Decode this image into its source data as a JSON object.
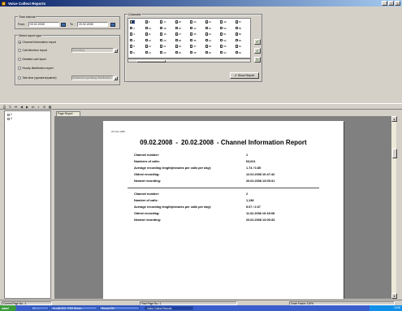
{
  "window": {
    "title": "Voice Collect Reports"
  },
  "time_interval": {
    "group_title": "Time interval",
    "from_label": "From",
    "from_value": "09.02.2008",
    "to_label": "To",
    "to_value": "20.02.2008"
  },
  "report_type": {
    "group_title": "Select report type",
    "options": [
      {
        "label": "Channel information report",
        "selected": true
      },
      {
        "label": "Call direction report",
        "selected": false,
        "extra": "Incoming"
      },
      {
        "label": "Detailed call report",
        "selected": false
      },
      {
        "label": "Hourly distribution report",
        "selected": false
      },
      {
        "label": "Talk time (speakers/paired)",
        "selected": false,
        "extra": "Minimum speaking distribution"
      }
    ]
  },
  "channels": {
    "group_title": "Channels",
    "columns": [
      [
        "1",
        "2",
        "3",
        "4",
        "5",
        "6"
      ],
      [
        "9",
        "10",
        "11",
        "12",
        "13",
        "14"
      ],
      [
        "17",
        "18",
        "19",
        "20",
        "21",
        "22"
      ],
      [
        "25",
        "26",
        "27",
        "28",
        "29",
        "30"
      ],
      [
        "33",
        "34",
        "35",
        "36",
        "37",
        "38"
      ],
      [
        "41",
        "42",
        "43",
        "44",
        "45",
        "46"
      ],
      [
        "49",
        "50",
        "51",
        "52",
        "53",
        "54"
      ],
      [
        "57",
        "58",
        "59",
        "60",
        "61",
        "62"
      ]
    ],
    "selected": "1"
  },
  "show_report_label": "Show Report",
  "tree": {
    "nodes": [
      "1",
      "2"
    ]
  },
  "tab_label": "Page Report",
  "report": {
    "print_date": "20 Feb 2008",
    "title_from": "09.02.2008",
    "title_sep": "-",
    "title_to": "20.02.2008",
    "title_rest": "- Channel Information Report",
    "sections": [
      {
        "rows": [
          {
            "key": "Channel number:",
            "value": "1"
          },
          {
            "key": "Numbers of calls:",
            "value": "63,621"
          },
          {
            "key": "Average recording length(minutes per calls per day):",
            "value": "1.74      /      0.85"
          },
          {
            "key": "Oldest recording:",
            "value": "12.02.2008   10:47:42"
          },
          {
            "key": "Newest recording:",
            "value": "20.02.2008   13:05:31"
          }
        ]
      },
      {
        "rows": [
          {
            "key": "Channel number:",
            "value": "2"
          },
          {
            "key": "Number of calls:",
            "value": "1,138"
          },
          {
            "key": "Average recording length(minutes per calls per day):",
            "value": "5.07      /      2.67"
          },
          {
            "key": "Oldest recording:",
            "value": "11.02.2008   10:18:08"
          },
          {
            "key": "Newest recording:",
            "value": "20.02.2008   13:05:33"
          }
        ]
      }
    ]
  },
  "statusbar": {
    "current_page": "Current Page No.: 1",
    "total_pages": "Total Page No.: 1",
    "zoom": "Zoom Factor: 100%"
  },
  "taskbar": {
    "start": "start",
    "tasks": [
      "1 - ...",
      "vc-cdk-004 - RDS Resou...",
      "Record DB",
      "Voice Collect Reports"
    ],
    "clock": "13:06"
  }
}
